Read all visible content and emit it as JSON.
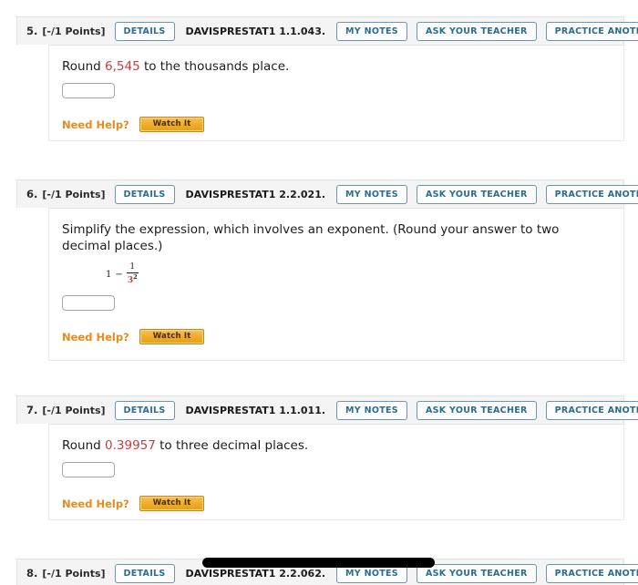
{
  "header_buttons": {
    "details": "DETAILS",
    "my_notes": "MY NOTES",
    "ask_teacher": "ASK YOUR TEACHER",
    "practice_another": "PRACTICE ANOTHER"
  },
  "need_help": {
    "label": "Need Help?",
    "watch_it": "Watch It"
  },
  "colors": {
    "highlight_value": "#cf3a3a",
    "button_border": "#6f95ab",
    "button_text": "#2b6c8f",
    "need_help_orange": "#e58c1a",
    "header_bg": "#f4f4f4"
  },
  "questions": [
    {
      "number": "5.",
      "points": "[-/1 Points]",
      "code": "DAVISPRESTAT1 1.1.043.",
      "prompt_prefix": "Round ",
      "prompt_value": "6,545",
      "prompt_suffix": " to the thousands place.",
      "answer_value": ""
    },
    {
      "number": "6.",
      "points": "[-/1 Points]",
      "code": "DAVISPRESTAT1 2.2.021.",
      "prompt": "Simplify the expression, which involves an exponent. (Round your answer to two decimal places.)",
      "math": {
        "lead": "1",
        "operator": "−",
        "numerator": "1",
        "denominator_base": "3",
        "denominator_exponent": "2"
      },
      "answer_value": ""
    },
    {
      "number": "7.",
      "points": "[-/1 Points]",
      "code": "DAVISPRESTAT1 1.1.011.",
      "prompt_prefix": "Round ",
      "prompt_value": "0.39957",
      "prompt_suffix": " to three decimal places.",
      "answer_value": ""
    },
    {
      "number": "8.",
      "points": "[-/1 Points]",
      "code": "DAVISPRESTAT1 2.2.062."
    }
  ]
}
